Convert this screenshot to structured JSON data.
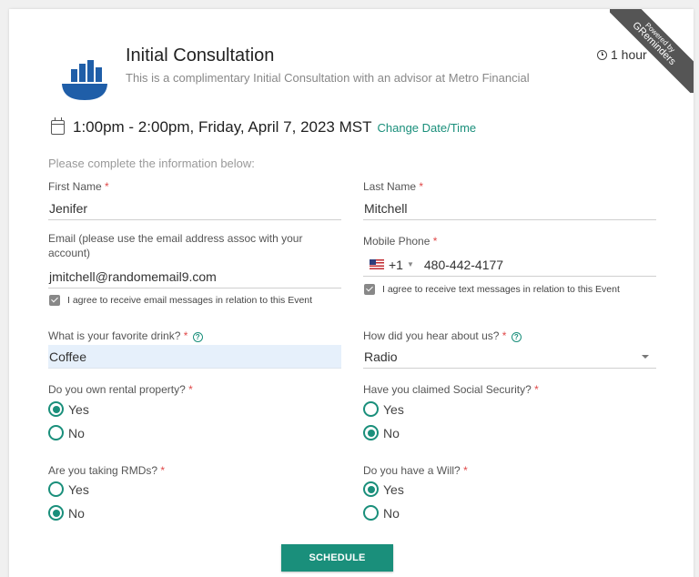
{
  "ribbon": {
    "line1": "Powered by",
    "line2": "GReminders"
  },
  "header": {
    "title": "Initial Consultation",
    "subtitle": "This is a complimentary Initial Consultation with an advisor at Metro Financial",
    "duration": "1 hour"
  },
  "datetime": {
    "text": "1:00pm - 2:00pm, Friday, April 7, 2023 MST",
    "change_link": "Change Date/Time"
  },
  "form": {
    "intro": "Please complete the information below:",
    "first_name": {
      "label": "First Name",
      "value": "Jenifer"
    },
    "last_name": {
      "label": "Last Name",
      "value": "Mitchell"
    },
    "email": {
      "label_line1": "Email (please use the email address assoc with your",
      "label_line2": "account)",
      "value": "jmitchell@randomemail9.com",
      "consent": "I agree to receive email messages in relation to this Event"
    },
    "mobile": {
      "label": "Mobile Phone",
      "dial_code": "+1",
      "value": "480-442-4177",
      "consent": "I agree to receive text messages in relation to this Event"
    },
    "drink": {
      "label": "What is your favorite drink?",
      "value": "Coffee"
    },
    "hear": {
      "label": "How did you hear about us?",
      "value": "Radio"
    },
    "rental": {
      "label": "Do you own rental property?",
      "options": [
        "Yes",
        "No"
      ],
      "selected": "Yes"
    },
    "social_security": {
      "label": "Have you claimed Social Security?",
      "options": [
        "Yes",
        "No"
      ],
      "selected": "No"
    },
    "rmds": {
      "label": "Are you taking RMDs?",
      "options": [
        "Yes",
        "No"
      ],
      "selected": "No"
    },
    "will": {
      "label": "Do you have a Will?",
      "options": [
        "Yes",
        "No"
      ],
      "selected": "Yes"
    },
    "schedule_label": "SCHEDULE"
  },
  "colors": {
    "accent": "#1a8f7b",
    "required": "#e04848",
    "highlight_field": "#e6f0fb",
    "logo": "#1f5ea8"
  },
  "icons": [
    "logo-icon",
    "clock-icon",
    "calendar-icon",
    "us-flag-icon",
    "help-icon",
    "checkbox-checked-icon",
    "dropdown-caret-icon"
  ]
}
